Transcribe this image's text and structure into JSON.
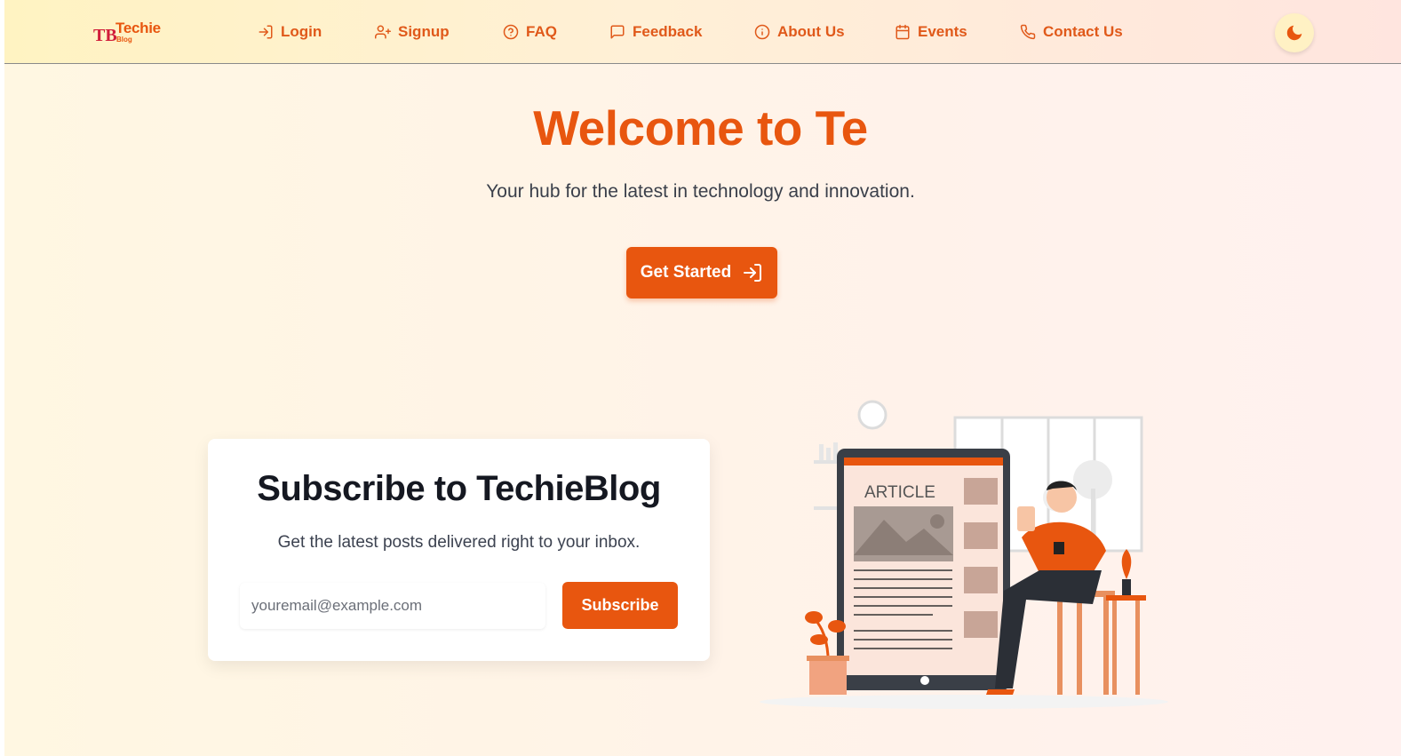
{
  "logo": {
    "title": "Techie",
    "subtitle": "Blog",
    "mark": "TB"
  },
  "nav": {
    "items": [
      {
        "label": "Login",
        "icon": "login-icon"
      },
      {
        "label": "Signup",
        "icon": "user-plus-icon"
      },
      {
        "label": "FAQ",
        "icon": "help-circle-icon"
      },
      {
        "label": "Feedback",
        "icon": "message-square-icon"
      },
      {
        "label": "About Us",
        "icon": "info-icon"
      },
      {
        "label": "Events",
        "icon": "calendar-icon"
      },
      {
        "label": "Contact Us",
        "icon": "phone-icon"
      }
    ],
    "theme_toggle_icon": "moon-icon"
  },
  "hero": {
    "title": "Welcome to Te",
    "subtitle": "Your hub for the latest in technology and innovation.",
    "cta_label": "Get Started",
    "cta_icon": "login-icon"
  },
  "subscribe": {
    "title": "Subscribe to TechieBlog",
    "subtitle": "Get the latest posts delivered right to your inbox.",
    "email_placeholder": "youremail@example.com",
    "email_value": "",
    "button_label": "Subscribe"
  },
  "illustration": {
    "article_label": "ARTICLE"
  },
  "colors": {
    "accent": "#e8560f",
    "text_dark": "#151821",
    "text_muted": "#3c4250"
  }
}
